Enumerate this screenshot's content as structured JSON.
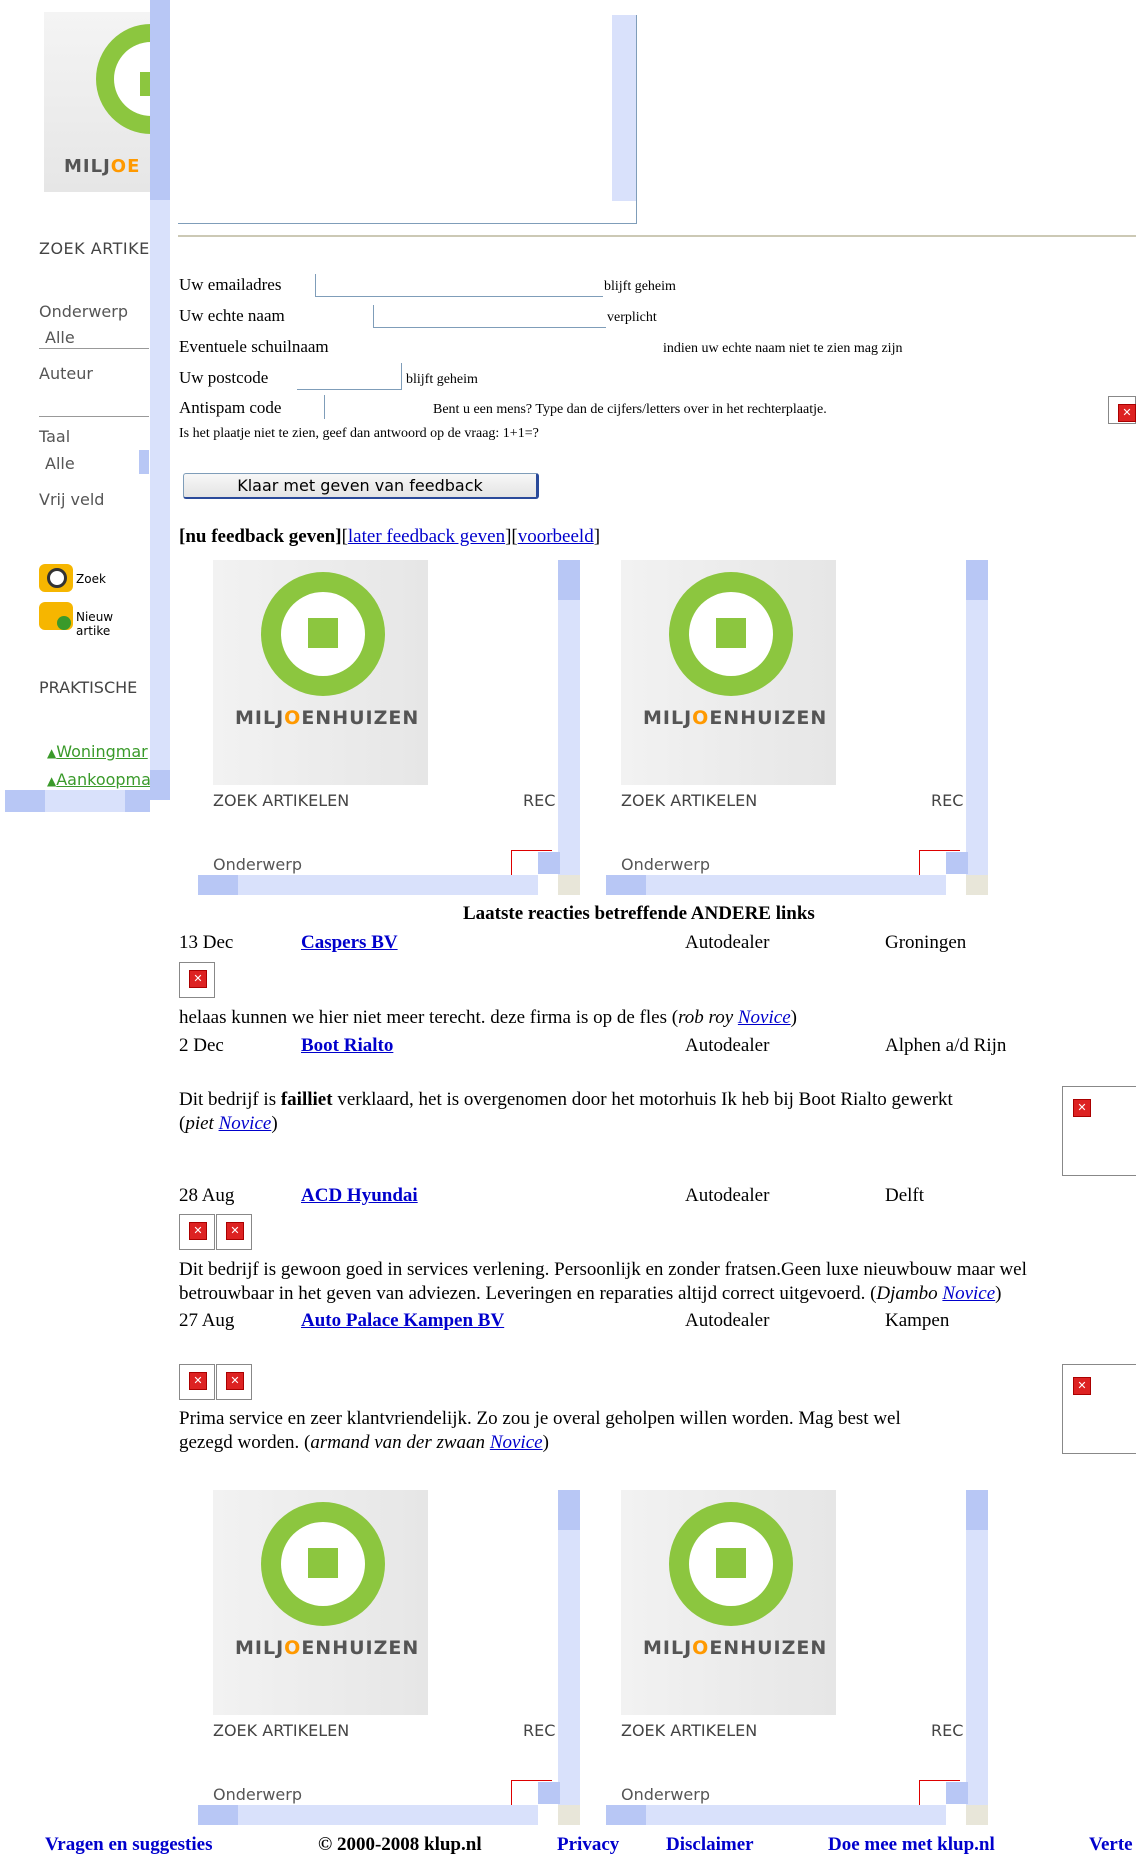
{
  "sidebar": {
    "logo_text_a": "MILJ",
    "logo_text_b": "OE",
    "zoek_title": "ZOEK ARTIKE",
    "onderwerp_label": "Onderwerp",
    "onderwerp_value": "Alle",
    "auteur_label": "Auteur",
    "taal_label": "Taal",
    "taal_value": "Alle",
    "vrij_label": "Vrij veld",
    "zoek_button": "Zoek",
    "nieuw_button": "Nieuw artike",
    "praktische_title": "PRAKTISCHE",
    "link1": "Woningmar",
    "link2": "Aankoopma"
  },
  "form": {
    "email_label": "Uw emailadres",
    "email_note": "blijft geheim",
    "naam_label": "Uw echte naam",
    "naam_note": "verplicht",
    "schuil_label": "Eventuele schuilnaam",
    "schuil_note": "indien uw echte naam niet te zien mag zijn",
    "postcode_label": "Uw postcode",
    "postcode_note": "blijft geheim",
    "antispam_label": "Antispam code",
    "antispam_note": "Bent u een mens? Type dan de cijfers/letters over in het rechterplaatje.",
    "antispam_fallback": "Is het plaatje niet te zien, geef dan antwoord op de vraag: 1+1=?",
    "submit_label": "Klaar met geven van feedback"
  },
  "feedback_nav": {
    "current": "[nu feedback geven]",
    "later": "later feedback geven",
    "voorbeeld": "voorbeeld",
    "open_bracket": "[",
    "mid_bracket": "][",
    "close_bracket": "]"
  },
  "mini_frame": {
    "logo_a": "MILJ",
    "logo_o": "O",
    "logo_b": "ENHUIZEN",
    "zoek": "ZOEK ARTIKELEN",
    "rec": "REC",
    "onderwerp": "Onderwerp"
  },
  "reacties": {
    "heading": "Laatste reacties betreffende ANDERE links",
    "items": [
      {
        "date": "13 Dec",
        "name": "Caspers BV",
        "category": "Autodealer",
        "city": "Groningen",
        "comment": "helaas kunnen we hier niet meer terecht. deze firma is op de fles",
        "author": "rob roy",
        "rank": "Novice"
      },
      {
        "date": "2 Dec",
        "name": "Boot Rialto",
        "category": "Autodealer",
        "city": "Alphen a/d Rijn",
        "comment_a": "Dit bedrijf is ",
        "comment_bold": "failliet",
        "comment_b": " verklaard, het is overgenomen door het motorhuis Ik heb bij Boot Rialto gewerkt",
        "author": "piet",
        "rank": "Novice"
      },
      {
        "date": "28 Aug",
        "name": "ACD Hyundai",
        "category": "Autodealer",
        "city": "Delft",
        "comment_line1": "Dit bedrijf is gewoon goed in services verlening. Persoonlijk en zonder fratsen.Geen luxe nieuwbouw maar wel",
        "comment_line2": "betrouwbaar in het geven van adviezen. Leveringen en reparaties altijd correct uitgevoerd.",
        "author": "Djambo",
        "rank": "Novice"
      },
      {
        "date": "27 Aug",
        "name": "Auto Palace Kampen BV",
        "category": "Autodealer",
        "city": "Kampen",
        "comment_line1": "Prima service en zeer klantvriendelijk. Zo zou je overal geholpen willen worden. Mag best wel",
        "comment_line2": "gezegd worden.",
        "author": "armand van der zwaan",
        "rank": "Novice"
      }
    ]
  },
  "footer": {
    "vragen": "Vragen en suggesties",
    "copyright": "© 2000-2008 klup.nl",
    "privacy": "Privacy",
    "disclaimer": "Disclaimer",
    "doe_mee": "Doe mee met klup.nl",
    "verte": "Verte"
  },
  "colors": {
    "logo_green": "#8cc63f",
    "logo_orange": "#ff9900",
    "link_blue": "#0000cc",
    "block_blue": "#b8c7f5"
  }
}
